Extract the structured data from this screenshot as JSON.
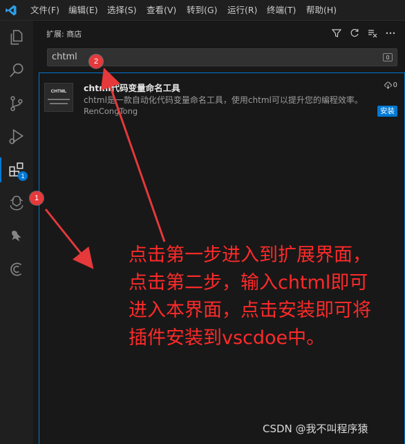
{
  "menu": [
    "文件(F)",
    "编辑(E)",
    "选择(S)",
    "查看(V)",
    "转到(G)",
    "运行(R)",
    "终端(T)",
    "帮助(H)"
  ],
  "activitybar": {
    "extensions_badge": "1",
    "icons": [
      "explorer-icon",
      "search-icon",
      "source-control-icon",
      "run-debug-icon",
      "extensions-icon",
      "chatgpt-icon",
      "bird-icon",
      "c-icon"
    ]
  },
  "sidebar": {
    "title": "扩展: 商店",
    "search_value": "chtml"
  },
  "extension": {
    "thumb_title": "CHTML",
    "name": "chtml代码变量命名工具",
    "description": "chtml是一款自动化代码变量命名工具，使用chtml可以提升您的编程效率。",
    "author": "RenCongTong",
    "downloads": "0",
    "install_label": "安装"
  },
  "markers": [
    "1",
    "2"
  ],
  "annotation_lines": [
    "点击第一步进入到扩展界面，",
    "点击第二步，输入chtml即可",
    "进入本界面，点击安装即可将",
    "插件安装到vscdoe中。"
  ],
  "watermark": "CSDN @我不叫程序猿",
  "colors": {
    "accent": "#0078d4",
    "annotation": "#ff2a2a",
    "marker": "#e5393b"
  }
}
